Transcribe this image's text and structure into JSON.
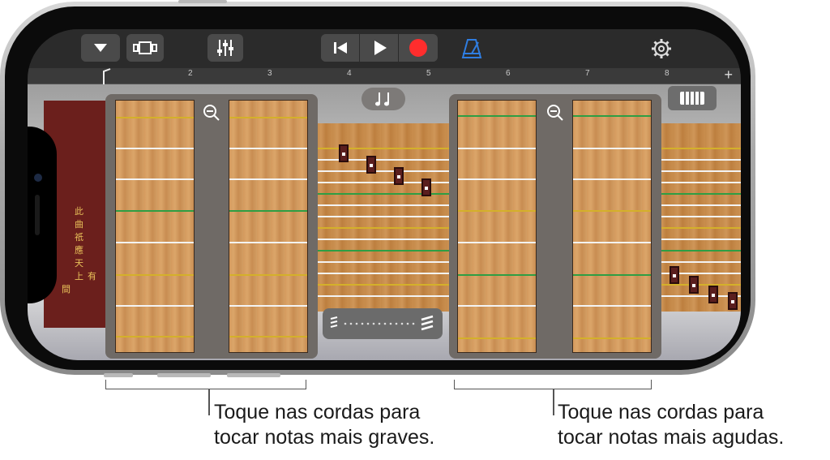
{
  "toolbar": {
    "buttons": [
      {
        "icon": "dropdown-triangle-icon"
      },
      {
        "icon": "browser-view-icon"
      },
      {
        "icon": "mixer-sliders-icon"
      },
      {
        "icon": "rewind-to-start-icon"
      },
      {
        "icon": "play-icon"
      },
      {
        "icon": "record-icon",
        "color": "#ff2d2d"
      },
      {
        "icon": "metronome-icon",
        "color": "#2f7de0"
      },
      {
        "icon": "settings-gear-icon"
      }
    ]
  },
  "ruler": {
    "marks": [
      "2",
      "3",
      "4",
      "5",
      "6",
      "7",
      "8"
    ],
    "add_symbol": "+"
  },
  "instrument": {
    "chord_button_icon": "music-notes-icon",
    "view_toggle_icon": "strings-view-icon",
    "zoom_icon": "zoom-out-icon",
    "glissando_control_icon": "glissando-slider-icon",
    "calligraphy": [
      "此",
      "曲",
      "祇",
      "應",
      "天",
      "上",
      "有",
      "間"
    ]
  },
  "captions": {
    "low_notes": [
      "Toque nas cordas para",
      "tocar notas mais graves."
    ],
    "high_notes": [
      "Toque nas cordas para",
      "tocar notas mais agudas."
    ]
  },
  "colors": {
    "record": "#ff2d2d",
    "metronome": "#2f7de0",
    "string_green": "#2e9e44",
    "string_gold": "#d4b02a",
    "string_white": "#f3f3f3"
  }
}
